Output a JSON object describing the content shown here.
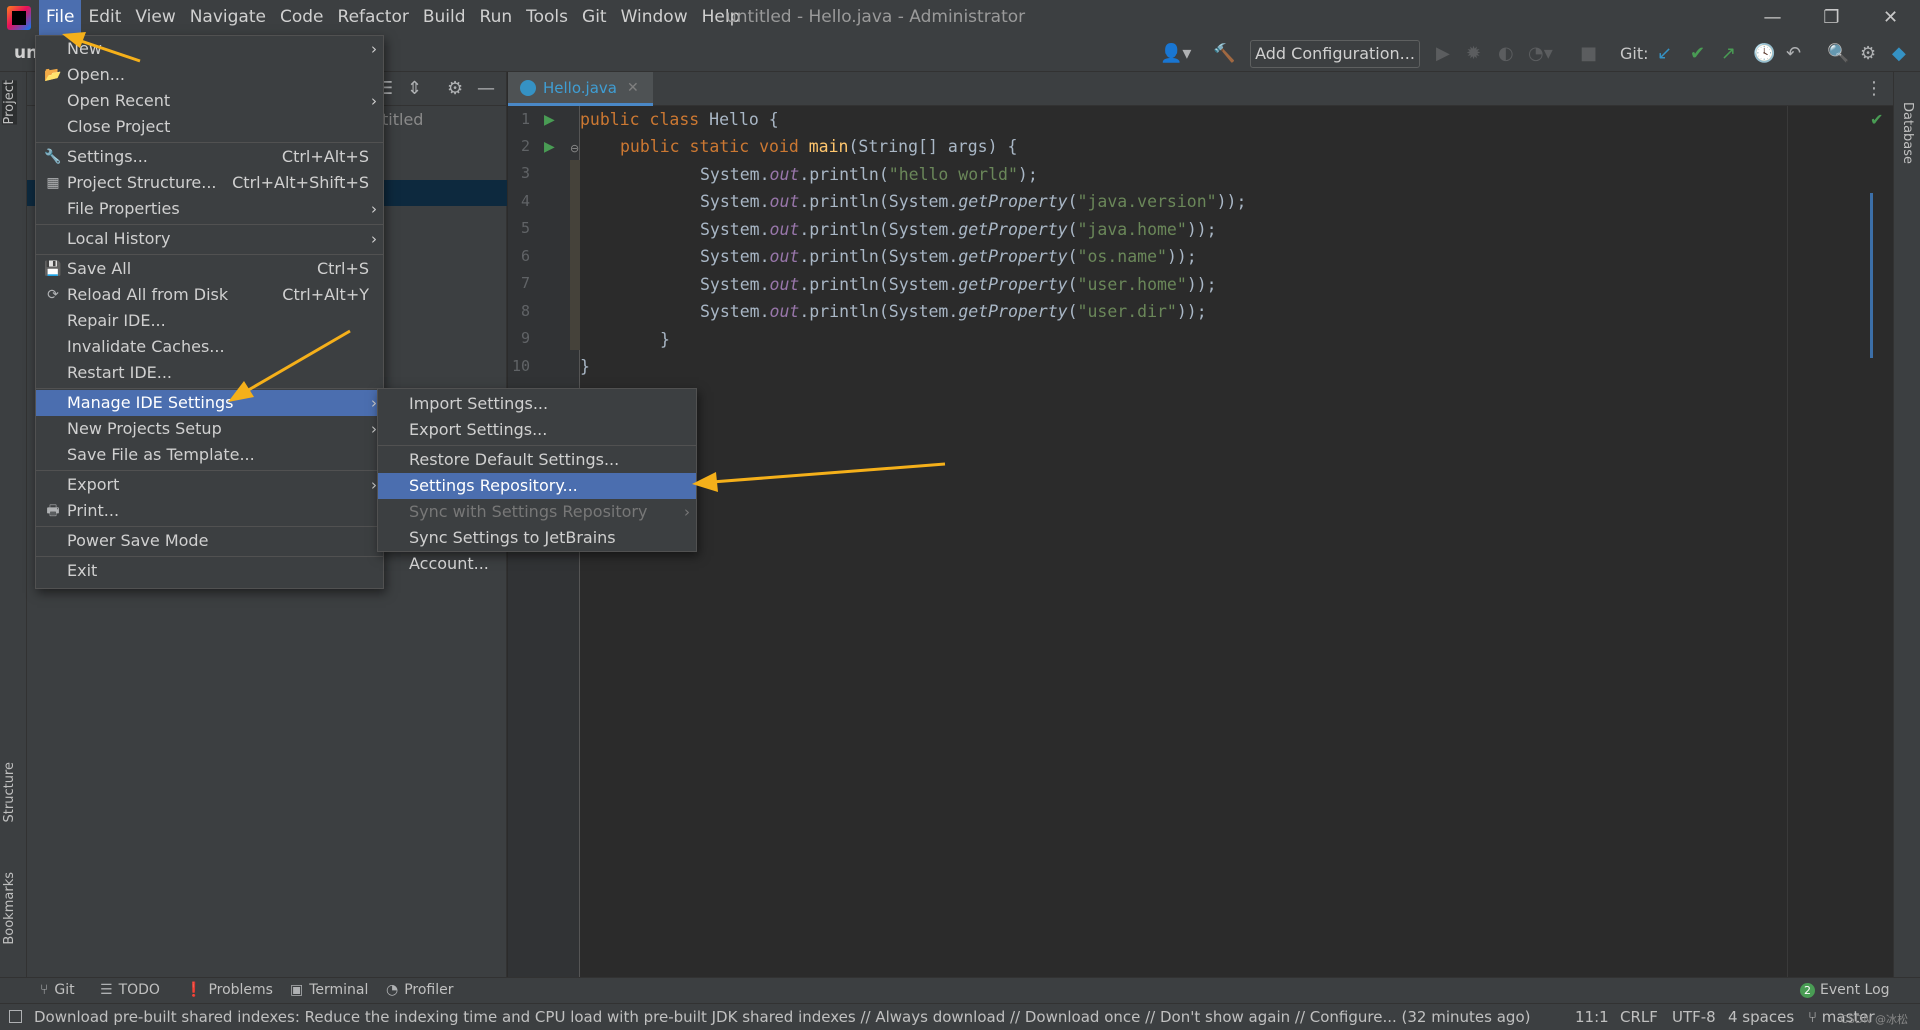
{
  "menubar": {
    "items": [
      "File",
      "Edit",
      "View",
      "Navigate",
      "Code",
      "Refactor",
      "Build",
      "Run",
      "Tools",
      "Git",
      "Window",
      "Help"
    ],
    "window_title": "untitled - Hello.java - Administrator"
  },
  "toolbar": {
    "project_crumb": "un",
    "add_configuration": "Add Configuration...",
    "git_label": "Git:"
  },
  "left_strip": {
    "project": "Project",
    "structure": "Structure",
    "bookmarks": "Bookmarks"
  },
  "right_strip": {
    "database": "Database"
  },
  "project_panel": {
    "tree_text": "titled"
  },
  "editor": {
    "tab_label": "Hello.java",
    "line_numbers": [
      "1",
      "2",
      "3",
      "4",
      "5",
      "6",
      "7",
      "8",
      "9",
      "10"
    ],
    "code": {
      "l1_kw": "public class ",
      "l1_rest": "Hello {",
      "l2_kw": "public static void ",
      "l2_method": "main",
      "l2_rest": "(String[] args) {",
      "sys": "System.",
      "out": "out",
      "println": ".println(",
      "get_prop": "System.",
      "get_prop_m": "getProperty",
      "hello": "\"hello world\"",
      "java_version": "\"java.version\"",
      "java_home": "\"java.home\"",
      "os_name": "\"os.name\"",
      "user_home": "\"user.home\"",
      "user_dir": "\"user.dir\"",
      "close1": ");",
      "open_paren": "(",
      "close2": "));",
      "brace_close_inner": "}",
      "brace_close_outer": "}"
    }
  },
  "file_menu": {
    "new": "New",
    "open": "Open...",
    "open_recent": "Open Recent",
    "close_project": "Close Project",
    "settings": "Settings...",
    "settings_sc": "Ctrl+Alt+S",
    "project_structure": "Project Structure...",
    "project_structure_sc": "Ctrl+Alt+Shift+S",
    "file_properties": "File Properties",
    "local_history": "Local History",
    "save_all": "Save All",
    "save_all_sc": "Ctrl+S",
    "reload_all": "Reload All from Disk",
    "reload_all_sc": "Ctrl+Alt+Y",
    "repair_ide": "Repair IDE...",
    "invalidate_caches": "Invalidate Caches...",
    "restart_ide": "Restart IDE...",
    "manage_ide_settings": "Manage IDE Settings",
    "new_projects_setup": "New Projects Setup",
    "save_file_as_template": "Save File as Template...",
    "export": "Export",
    "print": "Print...",
    "power_save_mode": "Power Save Mode",
    "exit": "Exit"
  },
  "submenu": {
    "import_settings": "Import Settings...",
    "export_settings": "Export Settings...",
    "restore_default": "Restore Default Settings...",
    "settings_repository": "Settings Repository...",
    "sync_with_repo": "Sync with Settings Repository",
    "sync_jetbrains": "Sync Settings to JetBrains Account..."
  },
  "bottom_tabs": {
    "git": "Git",
    "todo": "TODO",
    "problems": "Problems",
    "terminal": "Terminal",
    "profiler": "Profiler",
    "event_log": "Event Log",
    "event_count": "2"
  },
  "statusbar": {
    "message": "Download pre-built shared indexes: Reduce the indexing time and CPU load with pre-built JDK shared indexes // Always download // Download once // Don't show again // Configure... (32 minutes ago)",
    "position": "11:1",
    "line_sep": "CRLF",
    "encoding": "UTF-8",
    "indent": "4 spaces",
    "branch": "master",
    "watermark": "CSDN @冰松"
  },
  "colors": {
    "menu_highlight": "#4b6eaf",
    "keyword": "#cc7832",
    "string": "#6a8759",
    "field": "#9876aa",
    "method": "#ffc66d",
    "arrow": "#f5b01a"
  }
}
